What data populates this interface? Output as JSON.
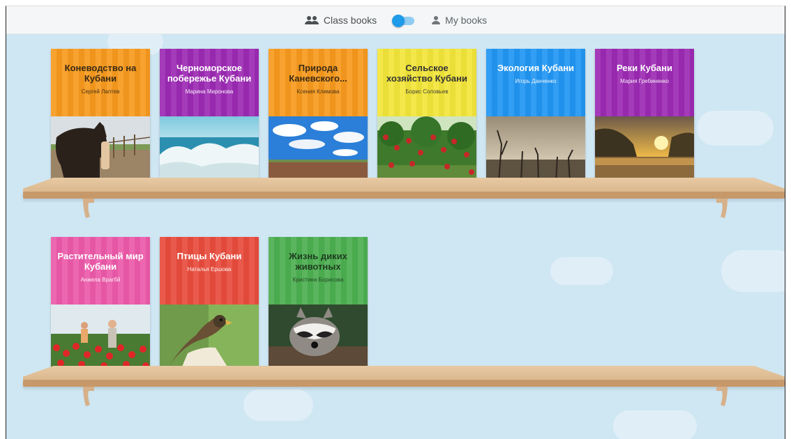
{
  "toggle": {
    "class_books_label": "Class books",
    "my_books_label": "My books",
    "state": "class"
  },
  "colors": {
    "orange": "#f79a1e",
    "purple": "#9c2ab3",
    "yellow": "#f2e53a",
    "blue": "#2196f3",
    "pink": "#ec5aa9",
    "red": "#e84c3d",
    "green": "#4caf50"
  },
  "shelves": [
    {
      "books": [
        {
          "title": "Коневодство на Кубани",
          "author": "Сергей Лаптев",
          "color": "#f79a1e",
          "picture": "horse"
        },
        {
          "title": "Черноморское побережье Кубани",
          "author": "Марина Миронова",
          "color": "#9c2ab3",
          "picture": "sea"
        },
        {
          "title": "Природа Каневского...",
          "author": "Ксения Климова",
          "color": "#f79a1e",
          "picture": "field"
        },
        {
          "title": "Сельское хозяйство Кубани",
          "author": "Борис Соловьев",
          "color": "#f2e53a",
          "picture": "apples"
        },
        {
          "title": "Экология Кубани",
          "author": "Игорь Данченко",
          "color": "#2196f3",
          "picture": "dead-trees"
        },
        {
          "title": "Реки Кубани",
          "author": "Мария Гребиненко",
          "color": "#9c2ab3",
          "picture": "river"
        }
      ]
    },
    {
      "books": [
        {
          "title": "Растительный мир Кубани",
          "author": "Анжела Врагбй",
          "color": "#ec5aa9",
          "picture": "tulips"
        },
        {
          "title": "Птицы Кубани",
          "author": "Наталья Ершова",
          "color": "#e84c3d",
          "picture": "falcon"
        },
        {
          "title": "Жизнь диких животных",
          "author": "Кристина Борисова",
          "color": "#4caf50",
          "picture": "raccoon"
        }
      ]
    }
  ]
}
